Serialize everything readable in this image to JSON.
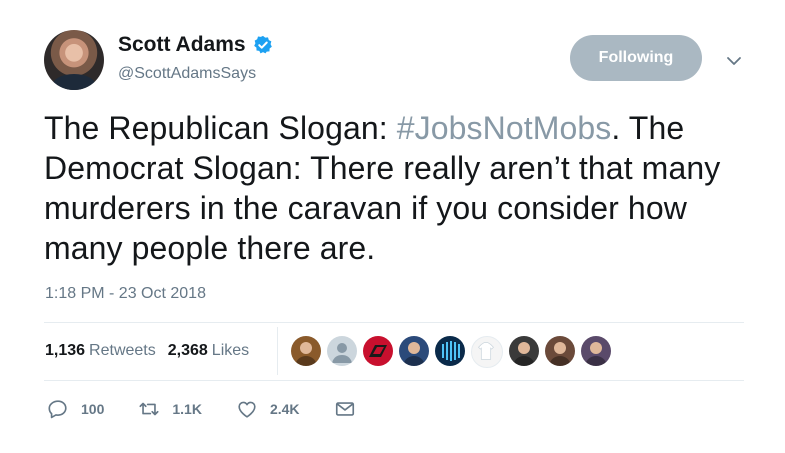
{
  "author": {
    "display_name": "Scott Adams",
    "handle": "@ScottAdamsSays",
    "verified": true,
    "avatar_icon": "profile-photo"
  },
  "follow_button": {
    "label": "Following",
    "color": "#aab8c2"
  },
  "menu": {
    "icon": "chevron-down-icon"
  },
  "tweet": {
    "text_part1": "The Republican Slogan: ",
    "hashtag": "#JobsNotMobs",
    "text_part2": ". The Democrat Slogan: There really aren’t that many murderers in the caravan if you consider how many people there are.",
    "hashtag_color": "#8899a6"
  },
  "timestamp": "1:18 PM - 23 Oct 2018",
  "stats": {
    "retweets_count": "1,136",
    "retweets_label": "Retweets",
    "likes_count": "2,368",
    "likes_label": "Likes"
  },
  "likers": [
    {
      "icon": "avatar-portrait-icon",
      "color": "#8a5a2b"
    },
    {
      "icon": "default-avatar-icon",
      "color": "#ccd6dd"
    },
    {
      "icon": "diamondbacks-logo-icon",
      "color": "#c8102e"
    },
    {
      "icon": "avatar-person-icon",
      "color": "#2b4a7a"
    },
    {
      "icon": "avatar-lights-icon",
      "color": "#0a2a4a"
    },
    {
      "icon": "avatar-shirt-icon",
      "color": "#f5f5f5"
    },
    {
      "icon": "avatar-woman-icon",
      "color": "#3a3a3a"
    },
    {
      "icon": "avatar-child-icon",
      "color": "#6b4a3a"
    },
    {
      "icon": "avatar-group-icon",
      "color": "#5a4a6a"
    }
  ],
  "actions": {
    "reply_count": "100",
    "retweet_count": "1.1K",
    "like_count": "2.4K"
  }
}
